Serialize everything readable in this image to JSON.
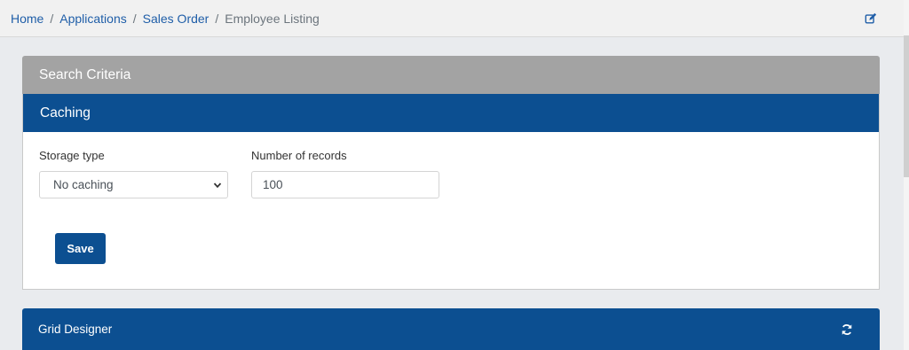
{
  "breadcrumb": {
    "items": [
      "Home",
      "Applications",
      "Sales Order",
      "Employee Listing"
    ],
    "separator": "/"
  },
  "header_icons": {
    "edit": "edit-icon"
  },
  "search_criteria": {
    "title": "Search Criteria"
  },
  "caching": {
    "title": "Caching",
    "storage_type_label": "Storage type",
    "storage_type_value": "No caching",
    "records_label": "Number of records",
    "records_value": "100",
    "save_label": "Save"
  },
  "grid_designer": {
    "title": "Grid Designer",
    "icon": "refresh-icon"
  },
  "colors": {
    "primary": "#0c4f91",
    "header_gray": "#a3a3a3",
    "link": "#1f5ea8"
  }
}
